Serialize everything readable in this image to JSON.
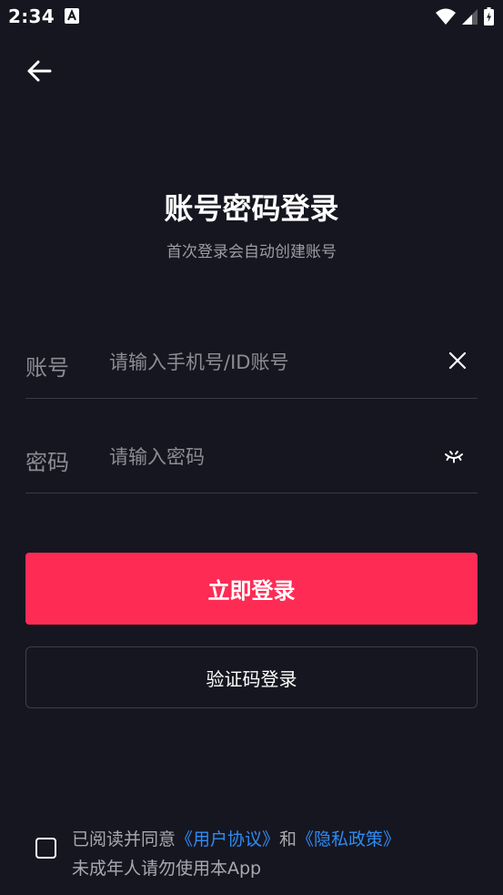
{
  "status_bar": {
    "time": "2:34"
  },
  "header": {
    "back_icon": "arrow-left-icon"
  },
  "title": "账号密码登录",
  "subtitle": "首次登录会自动创建账号",
  "account_field": {
    "label": "账号",
    "placeholder": "请输入手机号/ID账号",
    "value": "",
    "clear_icon": "close-icon"
  },
  "password_field": {
    "label": "密码",
    "placeholder": "请输入密码",
    "value": "",
    "visibility_icon": "eye-closed-icon"
  },
  "login_button_label": "立即登录",
  "code_login_button_label": "验证码登录",
  "agreement": {
    "checked": false,
    "prefix": "已阅读并同意",
    "user_agreement": "《用户协议》",
    "connector": "和",
    "privacy_policy": "《隐私政策》",
    "notice": "未成年人请勿使用本App"
  },
  "colors": {
    "background": "#161620",
    "primary": "#fe2c55",
    "link": "#2f8bf2"
  }
}
